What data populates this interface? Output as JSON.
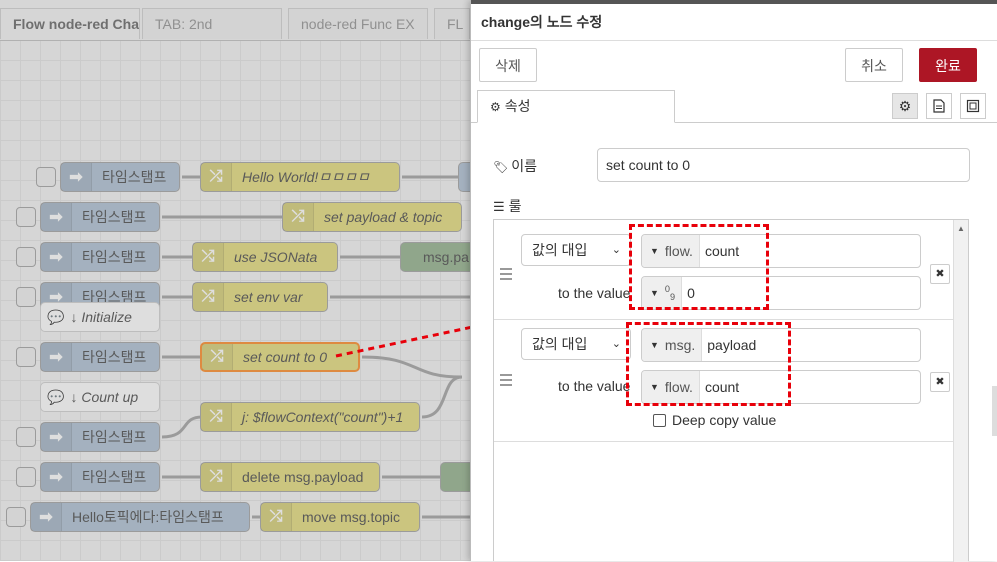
{
  "workspace": {
    "tabs": [
      {
        "label": "Flow node-red Cha",
        "active": true
      },
      {
        "label": "TAB: 2nd",
        "active": false
      },
      {
        "label": "node-red Func EX",
        "active": false
      },
      {
        "label": "FL",
        "active": false
      }
    ],
    "nodes": {
      "inject_labels": [
        "타임스탬프",
        "타임스탬프",
        "타임스탬프",
        "타임스탬프",
        "타임스탬프",
        "타임스탬프",
        "타임스탬프",
        "타임스탬프",
        "Hello토픽에다:타임스탬프"
      ],
      "change_labels": [
        "Hello World!ㅁㅁㅁㅁ",
        "set payload & topic",
        "use JSONata",
        "set env var",
        "set count to 0",
        "j: $flowContext(\"count\")+1",
        "delete msg.payload",
        "move msg.topic"
      ],
      "other_label": "msg.pa",
      "comment_labels": [
        "↓ Initialize",
        "↓ Count up"
      ]
    }
  },
  "tray": {
    "title": "change의 노드 수정",
    "delete_label": "삭제",
    "cancel_label": "취소",
    "done_label": "완료",
    "tab_properties": "속성",
    "name_label": "이름",
    "name_value": "set count to 0",
    "rules_label": "룰",
    "rules": [
      {
        "action": "값의 대입",
        "target_type": "flow.",
        "target_value": "count",
        "to_value_label": "to the value",
        "value_type": "0 9",
        "value": "0"
      },
      {
        "action": "값의 대입",
        "target_type": "msg.",
        "target_value": "payload",
        "to_value_label": "to the value",
        "value_type": "flow.",
        "value": "count",
        "deep_copy_label": "Deep copy value"
      }
    ]
  },
  "colors": {
    "done_button": "#ad1625",
    "inject_node": "#a6bbcf",
    "change_node": "#e2d96e",
    "annotation_red": "#e8000a",
    "selected_outline": "#ff7f0e"
  }
}
